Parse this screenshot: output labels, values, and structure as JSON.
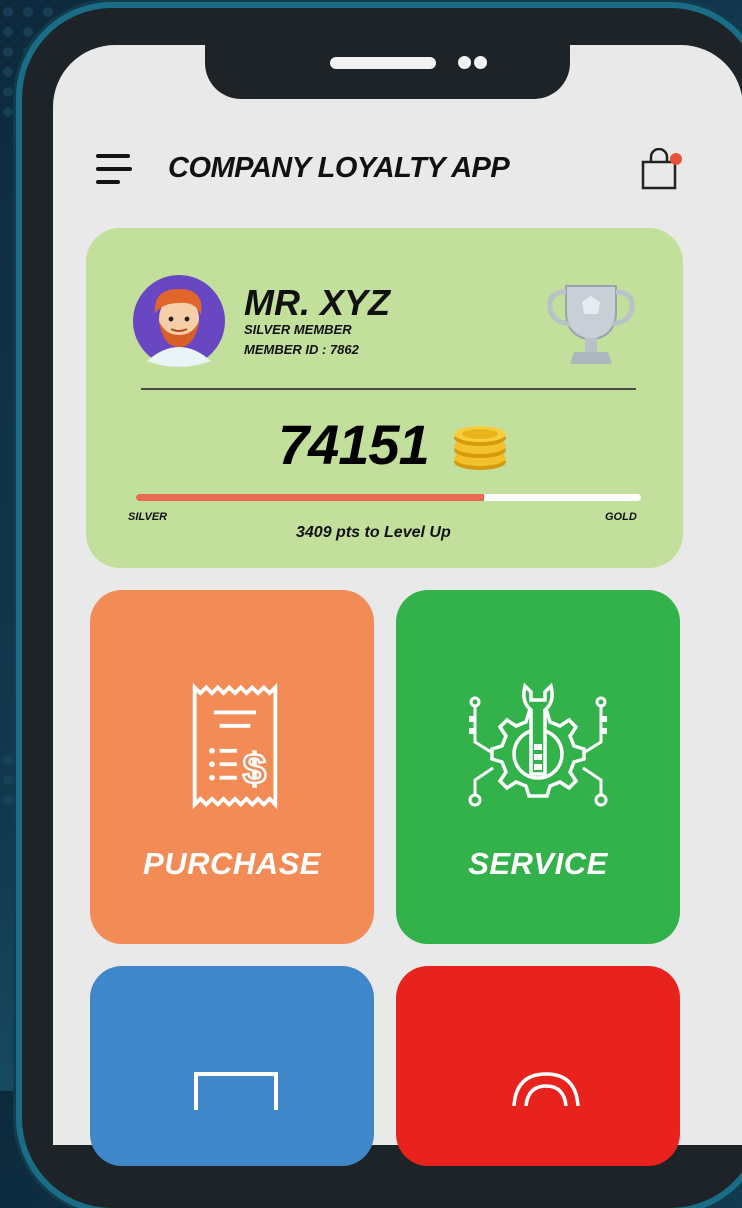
{
  "header": {
    "title": "COMPANY LOYALTY APP",
    "menu_icon": "hamburger-menu-icon",
    "cart_icon": "shopping-bag-icon",
    "notification_color": "#e8523a"
  },
  "member": {
    "name": "MR. XYZ",
    "tier": "SILVER MEMBER",
    "member_id": "MEMBER ID : 7862",
    "points": "74151",
    "level_start": "SILVER",
    "level_end": "GOLD",
    "points_to_next": "3409 pts to Level Up",
    "progress_fraction": 0.69,
    "card_color": "#c3df9c",
    "progress_color": "#ea6b50"
  },
  "tiles": [
    {
      "label": "PURCHASE",
      "icon": "receipt-icon",
      "color": "#f28b55"
    },
    {
      "label": "SERVICE",
      "icon": "gear-wrench-icon",
      "color": "#33b14a"
    },
    {
      "label": "",
      "icon": "document-icon",
      "color": "#3f87c9"
    },
    {
      "label": "",
      "icon": "target-icon",
      "color": "#e8231e"
    }
  ]
}
